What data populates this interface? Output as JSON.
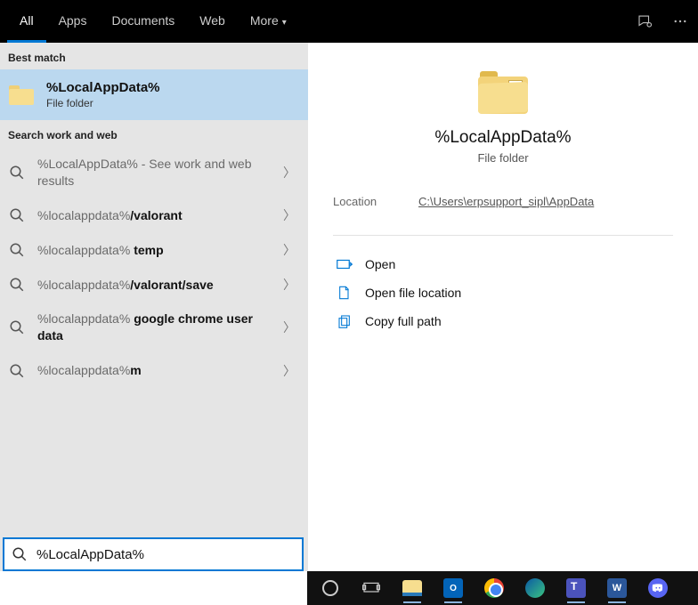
{
  "topbar": {
    "tabs": [
      "All",
      "Apps",
      "Documents",
      "Web",
      "More"
    ],
    "active_index": 0
  },
  "left": {
    "section_best": "Best match",
    "best_match": {
      "title": "%LocalAppData%",
      "subtitle": "File folder"
    },
    "section_search": "Search work and web",
    "results": [
      {
        "prefix": "%LocalAppData%",
        "suffix": "",
        "trail": " - See work and web results"
      },
      {
        "prefix": "%localappdata%",
        "suffix": "/valorant",
        "trail": ""
      },
      {
        "prefix": "%localappdata% ",
        "suffix": "temp",
        "trail": ""
      },
      {
        "prefix": "%localappdata%",
        "suffix": "/valorant/save",
        "trail": ""
      },
      {
        "prefix": "%localappdata% ",
        "suffix": "google chrome user data",
        "trail": ""
      },
      {
        "prefix": "%localappdata%",
        "suffix": "m",
        "trail": ""
      }
    ]
  },
  "preview": {
    "title": "%LocalAppData%",
    "subtitle": "File folder",
    "location_label": "Location",
    "location_value": "C:\\Users\\erpsupport_sipl\\AppData",
    "actions": [
      "Open",
      "Open file location",
      "Copy full path"
    ]
  },
  "search": {
    "value": "%LocalAppData%"
  },
  "taskbar": {
    "items": [
      "cortana",
      "taskview",
      "explorer",
      "outlook",
      "chrome",
      "edge",
      "teams",
      "word",
      "discord"
    ]
  }
}
